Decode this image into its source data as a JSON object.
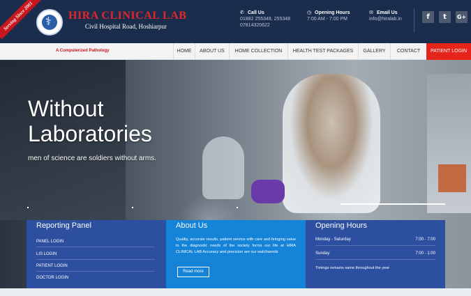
{
  "header": {
    "ribbon": "Serving Since 2001",
    "brand": "HIRA CLINICAL LAB",
    "address": "Civil Hospital Road, Hoshiarpur",
    "call": {
      "title": "Call Us",
      "line1": "01882 255348, 255348",
      "line2": "07814320622",
      "icon": "phone-icon"
    },
    "hours": {
      "title": "Opening Hours",
      "value": "7:00 AM - 7:00 PM",
      "icon": "clock-icon"
    },
    "email": {
      "title": "Email Us",
      "value": "info@hiralab.in",
      "icon": "mail-icon"
    },
    "social": [
      {
        "glyph": "f",
        "icon": "facebook-icon"
      },
      {
        "glyph": "t",
        "icon": "twitter-icon"
      },
      {
        "glyph": "G+",
        "icon": "google-plus-icon"
      }
    ]
  },
  "nav": {
    "tagline": "A Computerized Pathology",
    "items": [
      "HOME",
      "ABOUT US",
      "HOME COLLECTION",
      "HEALTH TEST PACKAGES",
      "GALLERY",
      "CONTACT",
      "PATIENT LOGIN"
    ]
  },
  "hero": {
    "title_line1": "Without",
    "title_line2": "Laboratories",
    "subtitle": "men of science are soldiers without arms."
  },
  "panels": {
    "reporting": {
      "title": "Reporting Panel",
      "links": [
        "PANEL LOGIN",
        "LIS LOGIN",
        "PATIENT LOGIN",
        "DOCTOR LOGIN"
      ]
    },
    "about": {
      "title": "About Us",
      "text": "Quality, accurate results, patient service with care and bringing value to the diagnostic needs of the society forms our life at HIRA CLINICAL LAB Accuracy and precision are our watchwords",
      "button": "Read more"
    },
    "hours": {
      "title": "Opening Hours",
      "rows": [
        {
          "day": "Monday - Saturday",
          "time": "7:00 - 7:00"
        },
        {
          "day": "Sunday",
          "time": "7:00 - 1:00"
        }
      ],
      "note": "Timings remains same throughout the year"
    }
  },
  "colors": {
    "header_bg": "#1b2d4d",
    "brand_red": "#e3262c",
    "panel_dark": "#2c4fa0",
    "panel_light": "#1483d8",
    "active_nav": "#e5241b"
  }
}
